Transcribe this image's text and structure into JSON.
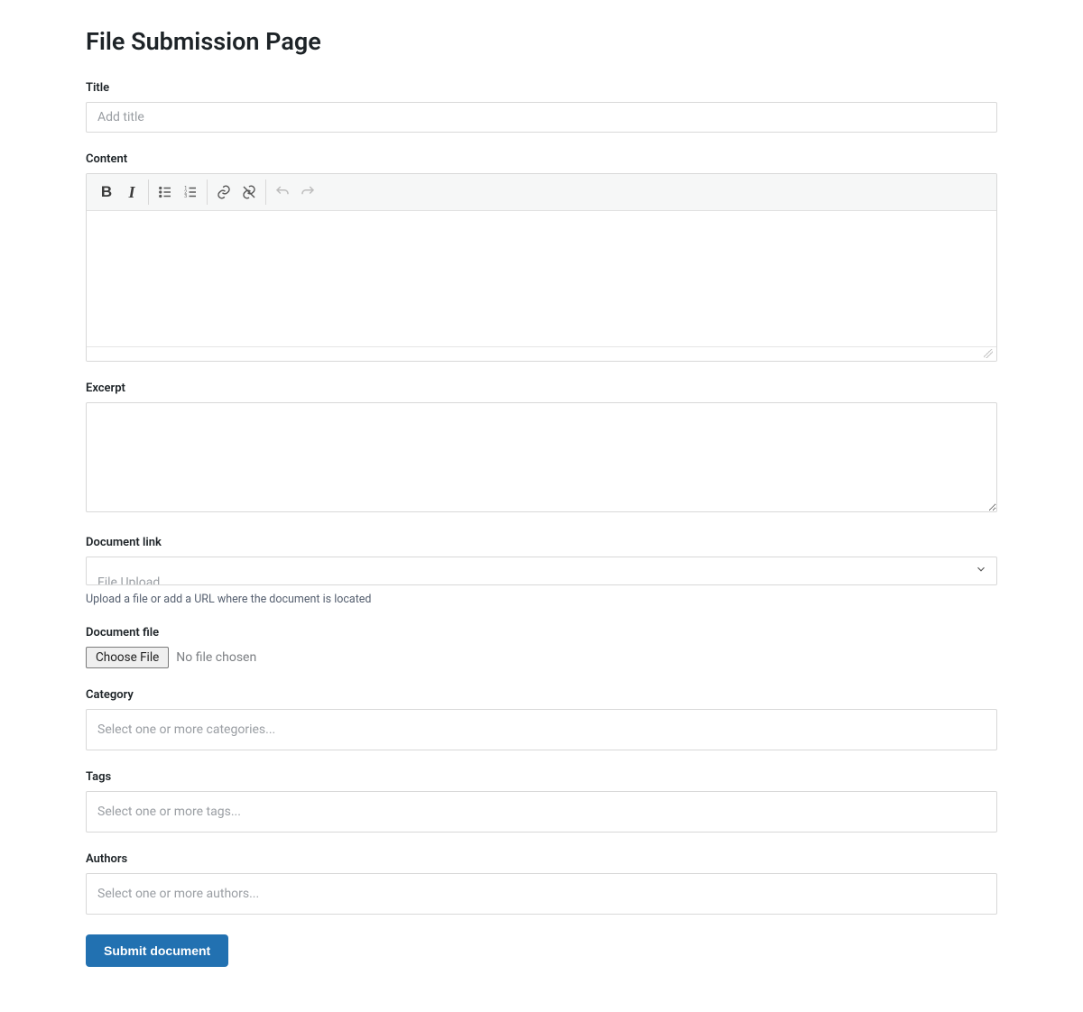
{
  "page": {
    "title": "File Submission Page"
  },
  "title_field": {
    "label": "Title",
    "placeholder": "Add title",
    "value": ""
  },
  "content_field": {
    "label": "Content",
    "toolbar": {
      "bold": "B",
      "italic": "I"
    },
    "value": ""
  },
  "excerpt_field": {
    "label": "Excerpt",
    "value": ""
  },
  "document_link": {
    "label": "Document link",
    "selected": "File Upload",
    "helper": "Upload a file or add a URL where the document is located"
  },
  "document_file": {
    "label": "Document file",
    "button": "Choose File",
    "status": "No file chosen"
  },
  "category_field": {
    "label": "Category",
    "placeholder": "Select one or more categories..."
  },
  "tags_field": {
    "label": "Tags",
    "placeholder": "Select one or more tags..."
  },
  "authors_field": {
    "label": "Authors",
    "placeholder": "Select one or more authors..."
  },
  "submit": {
    "label": "Submit document"
  }
}
